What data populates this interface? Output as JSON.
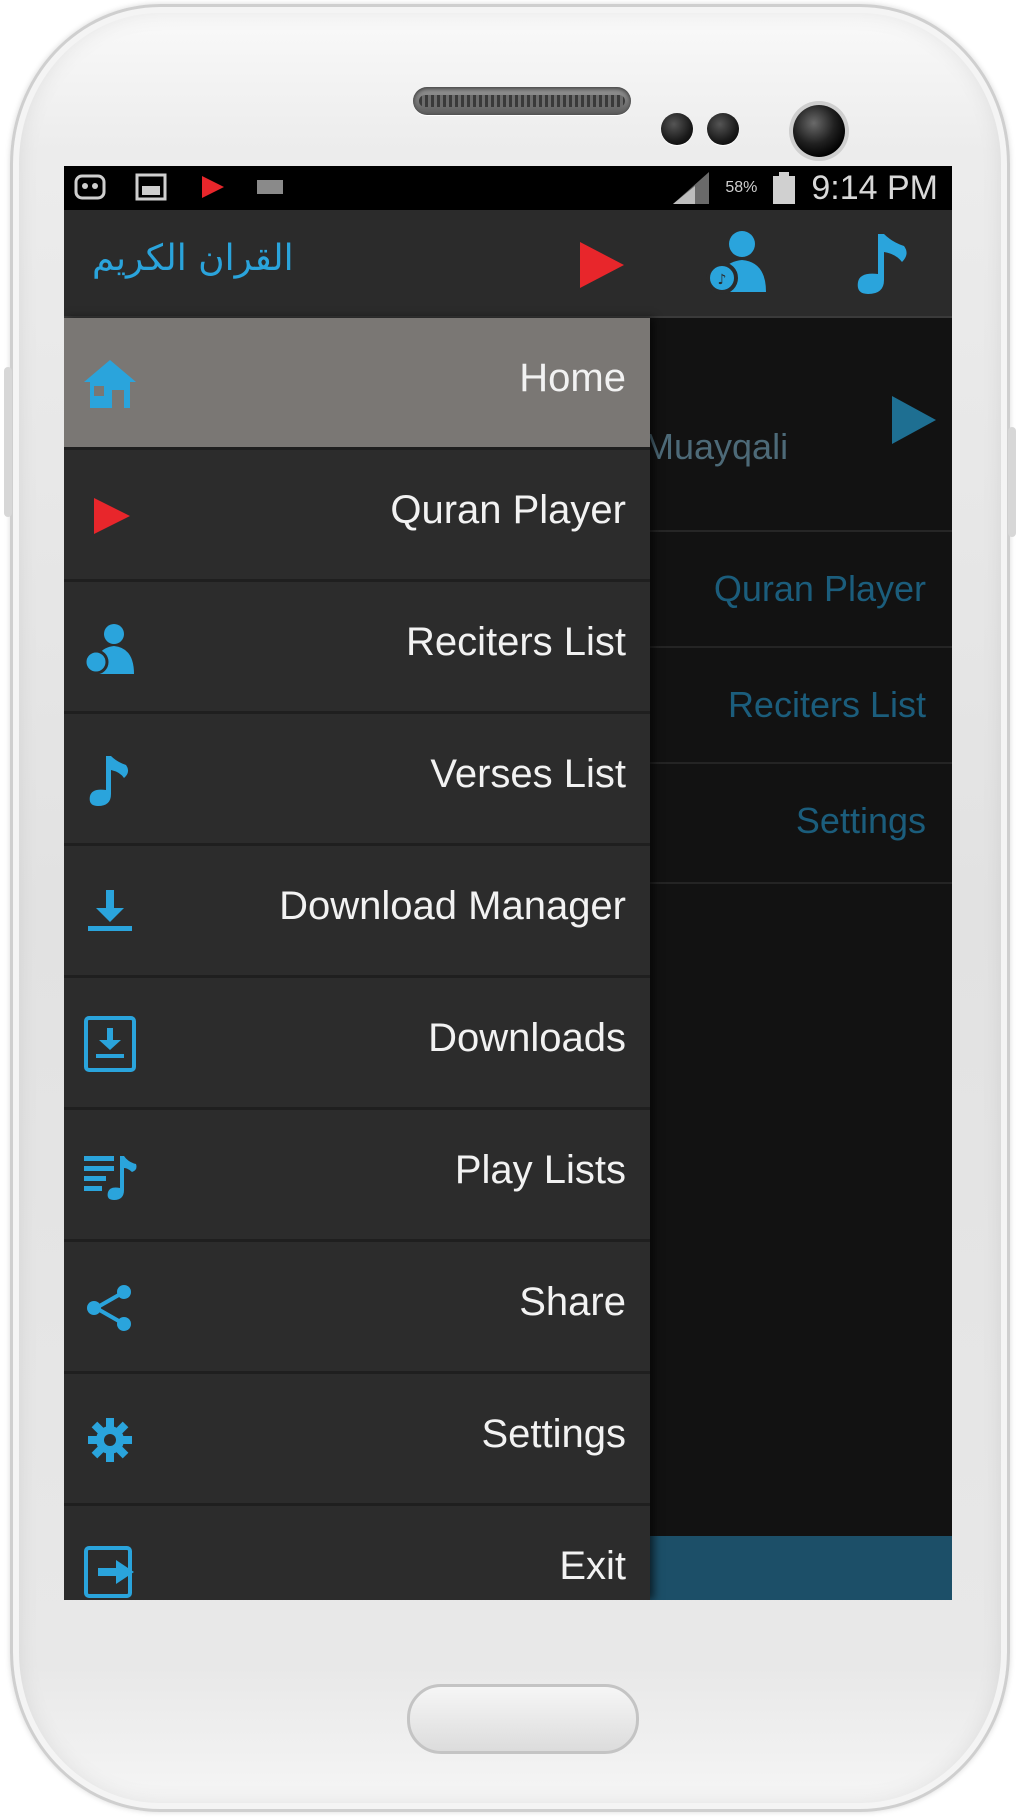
{
  "status_bar": {
    "time": "9:14 PM",
    "battery": "58%"
  },
  "action_bar": {
    "title": "القران الكريم",
    "icons": [
      "play-icon",
      "reciter-icon",
      "music-note-icon"
    ]
  },
  "background": {
    "now_playing": "Muayqali",
    "rows": [
      "Quran Player",
      "Reciters List",
      "Settings"
    ]
  },
  "drawer": {
    "items": [
      {
        "label": "Home",
        "icon": "home-icon"
      },
      {
        "label": "Quran Player",
        "icon": "play-icon"
      },
      {
        "label": "Reciters List",
        "icon": "reciter-icon"
      },
      {
        "label": "Verses List",
        "icon": "music-note-icon"
      },
      {
        "label": "Download Manager",
        "icon": "download-icon"
      },
      {
        "label": "Downloads",
        "icon": "downloads-folder-icon"
      },
      {
        "label": "Play Lists",
        "icon": "playlist-icon"
      },
      {
        "label": "Share",
        "icon": "share-icon"
      },
      {
        "label": "Settings",
        "icon": "gear-icon"
      },
      {
        "label": "Exit",
        "icon": "exit-icon"
      }
    ]
  },
  "colors": {
    "accent": "#2aa4dc",
    "play_red": "#e8262b",
    "active_item": "#7a7774",
    "drawer_bg": "#2c2c2c"
  }
}
